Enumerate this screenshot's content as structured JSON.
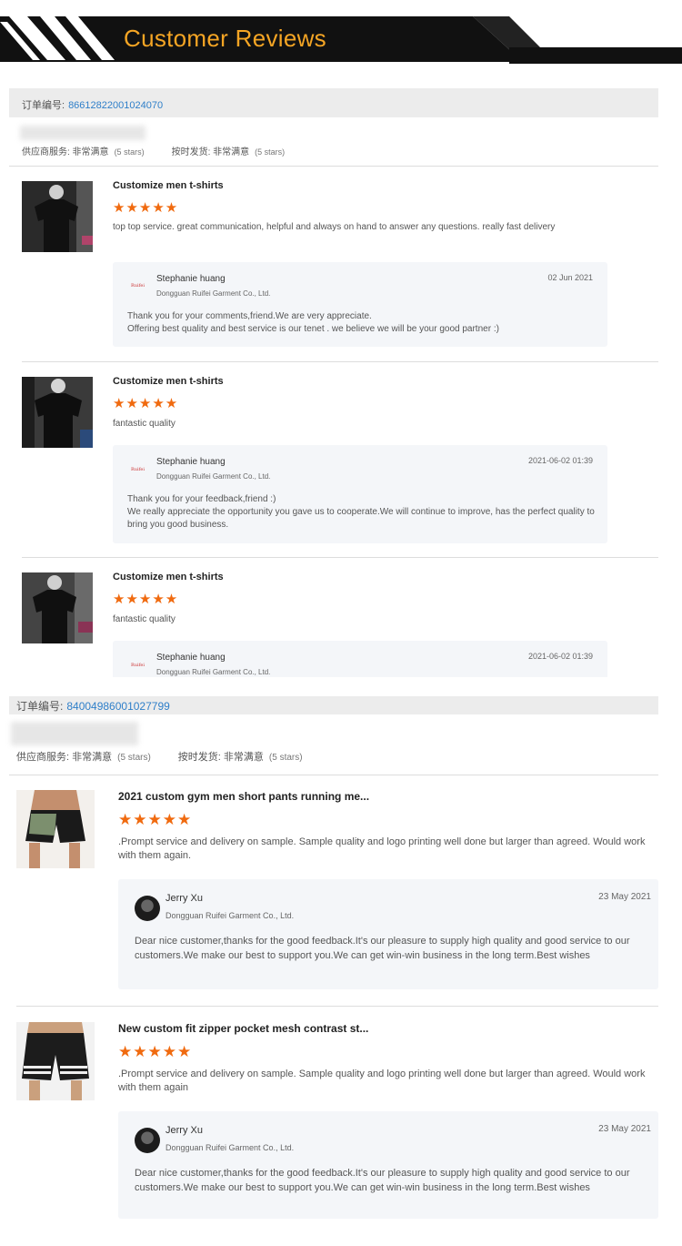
{
  "banner": {
    "title": "Customer Reviews"
  },
  "orders": [
    {
      "order_label": "订单编号:",
      "order_number": "86612822001024070",
      "supplier_service": "供应商服务: 非常满意",
      "supplier_stars": "(5 stars)",
      "ontime_shipping": "按时发货: 非常满意",
      "ontime_stars": "(5 stars)",
      "reviews": [
        {
          "product_title": "Customize men t-shirts",
          "stars": "★★★★★",
          "text": "top top service. great communication, helpful and always on hand to answer any questions. really fast delivery",
          "reply": {
            "name": "Stephanie huang",
            "company": "Dongguan Ruifei Garment Co., Ltd.",
            "date": "02 Jun 2021",
            "logo": "Ruifei",
            "body": "Thank you for your comments,friend.We are very appreciate.\nOffering best quality and best service is our tenet . we believe we will be your good partner :)"
          }
        },
        {
          "product_title": "Customize men t-shirts",
          "stars": "★★★★★",
          "text": "fantastic quality",
          "reply": {
            "name": "Stephanie huang",
            "company": "Dongguan Ruifei Garment Co., Ltd.",
            "date": "2021-06-02 01:39",
            "logo": "Ruifei",
            "body": "Thank you for your feedback,friend :)\nWe really appreciate the opportunity you gave us to cooperate.We will continue to improve, has the perfect quality to bring you good business."
          }
        },
        {
          "product_title": "Customize men t-shirts",
          "stars": "★★★★★",
          "text": "fantastic quality",
          "reply": {
            "name": "Stephanie huang",
            "company": "Dongguan Ruifei Garment Co., Ltd.",
            "date": "2021-06-02 01:39",
            "logo": "Ruifei"
          }
        }
      ]
    },
    {
      "order_label": "订单编号:",
      "order_number": "84004986001027799",
      "supplier_service": "供应商服务: 非常满意",
      "supplier_stars": "(5 stars)",
      "ontime_shipping": "按时发货: 非常满意",
      "ontime_stars": "(5 stars)",
      "reviews": [
        {
          "product_title": "2021 custom gym men short pants running me...",
          "stars": "★★★★★",
          "text": ".Prompt service and delivery on sample. Sample quality and logo printing well done but larger than agreed. Would work with them again.",
          "reply": {
            "name": "Jerry Xu",
            "company": "Dongguan Ruifei Garment Co., Ltd.",
            "date": "23 May 2021",
            "body": "Dear nice customer,thanks for the good feedback.It's our pleasure to supply high quality and good service to our customers.We make our best to support you.We can get win-win business in the long term.Best wishes"
          }
        },
        {
          "product_title": "New custom fit zipper pocket mesh contrast st...",
          "stars": "★★★★★",
          "text": ".Prompt service and delivery on sample. Sample quality and logo printing well done but larger than agreed. Would work with them again",
          "reply": {
            "name": "Jerry Xu",
            "company": "Dongguan Ruifei Garment Co., Ltd.",
            "date": "23 May 2021",
            "body": "Dear nice customer,thanks for the good feedback.It's our pleasure to supply high quality and good service to our customers.We make our best to support you.We can get win-win business in the long term.Best wishes"
          }
        }
      ]
    }
  ],
  "colors": {
    "star": "#f06a0f",
    "banner_text": "#f5a524",
    "order_link": "#2f7fc9"
  }
}
